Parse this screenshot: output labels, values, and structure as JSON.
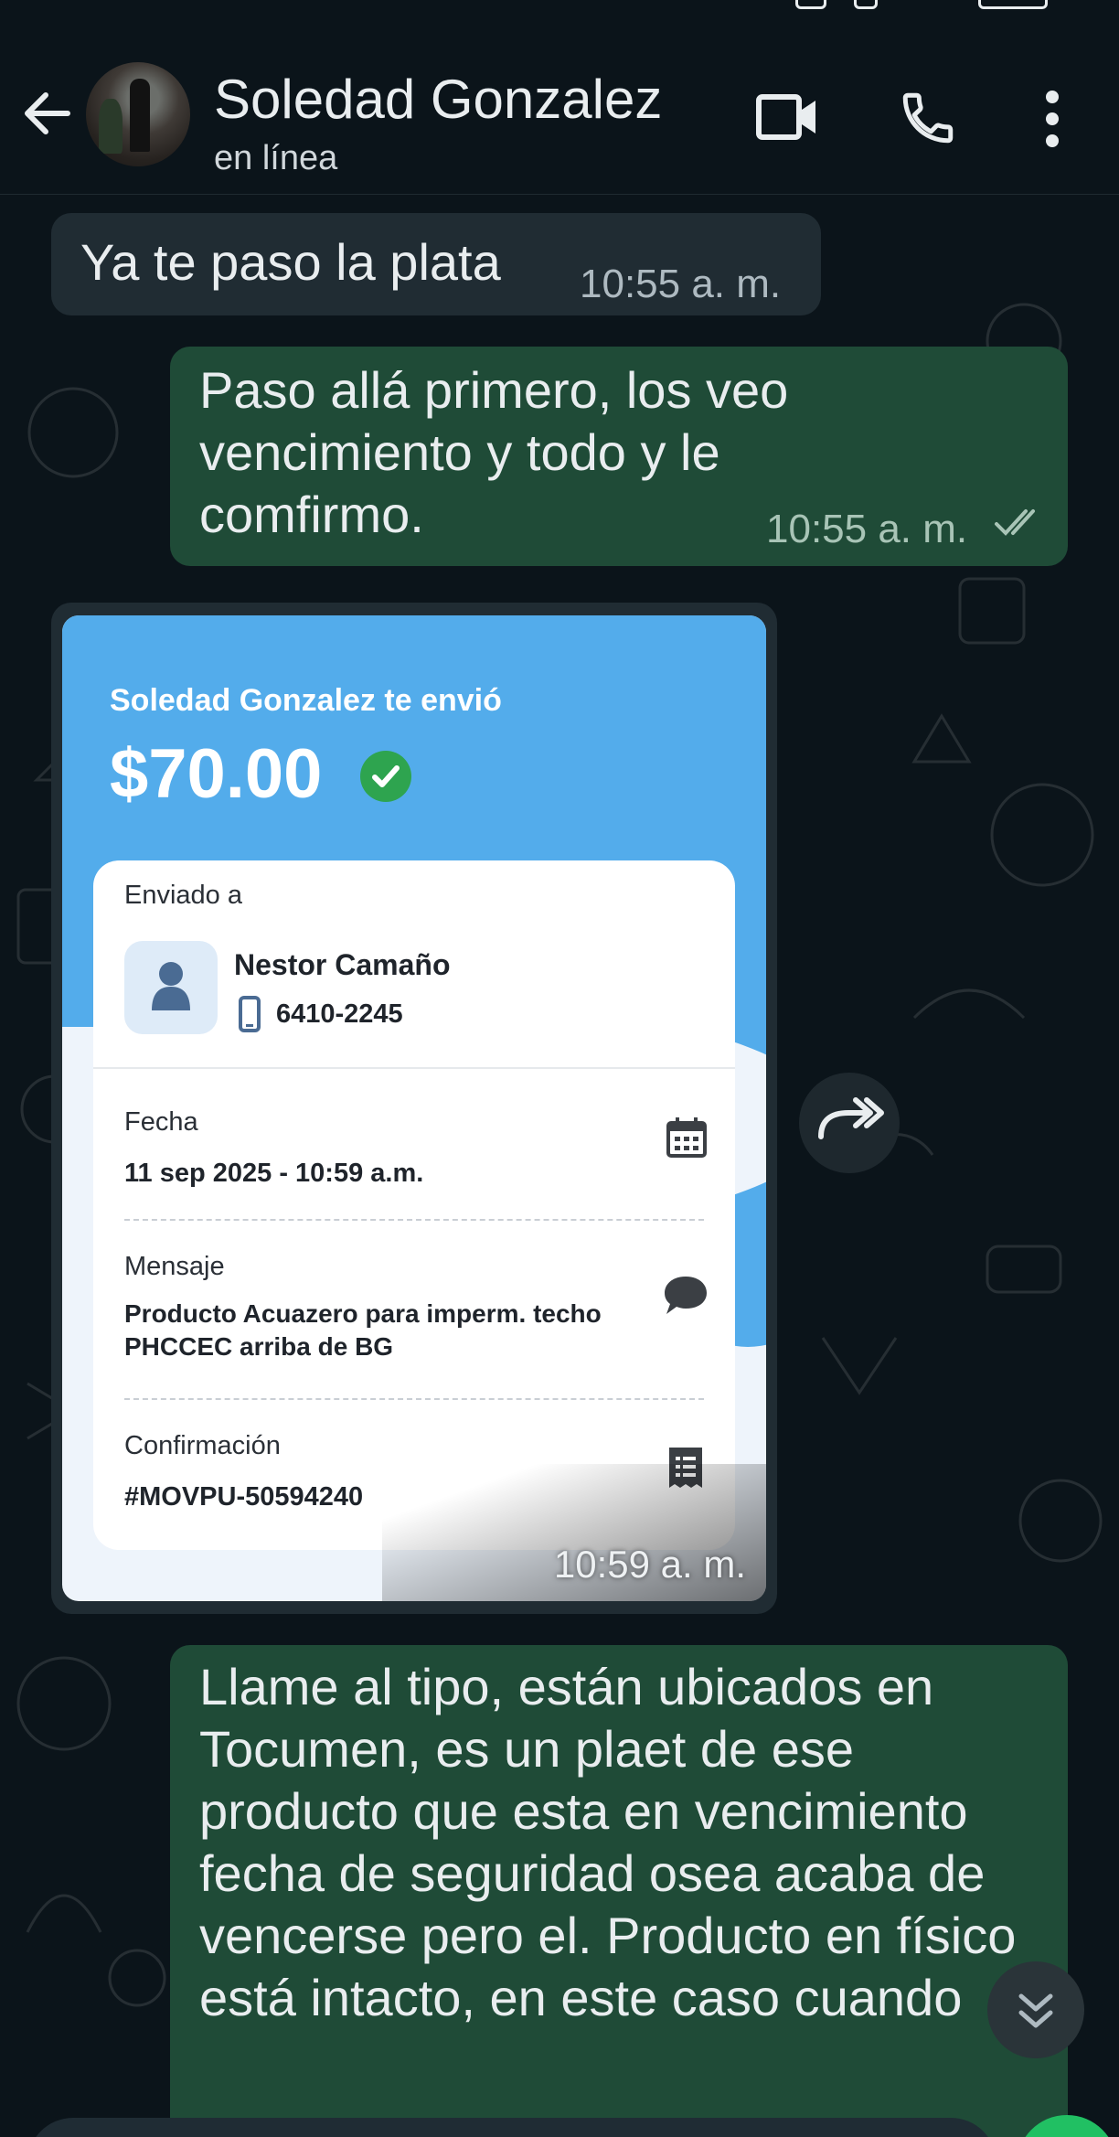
{
  "header": {
    "contact_name": "Soledad Gonzalez",
    "contact_status": "en línea",
    "icons": {
      "back": "back-arrow-icon",
      "video": "video-call-icon",
      "call": "phone-icon",
      "menu": "more-vert-icon"
    }
  },
  "colors": {
    "background": "#0b141a",
    "incoming_bubble": "#202c33",
    "outgoing_bubble": "#1f4b37",
    "receipt_accent": "#53aceb",
    "online_green": "#21c063"
  },
  "messages": [
    {
      "direction": "in",
      "text": "Ya te paso la plata",
      "time": "10:55 a. m."
    },
    {
      "direction": "out",
      "text": "Paso allá primero, los veo vencimiento y todo y le comfirmo.",
      "time": "10:55 a. m.",
      "ticks": "double-check-icon"
    },
    {
      "direction": "in",
      "type": "image",
      "time": "10:59 a. m."
    },
    {
      "direction": "out",
      "text": "Llame al tipo, están ubicados en Tocumen, es un plaet de ese producto que esta en vencimiento fecha de seguridad osea acaba de vencerse pero el. Producto en físico está intacto,   en este caso cuando"
    }
  ],
  "receipt": {
    "sender_line": "Soledad Gonzalez te envió",
    "amount": "$70.00",
    "sent_to_label": "Enviado a",
    "recipient_name": "Nestor Camaño",
    "recipient_phone": "6410-2245",
    "date_label": "Fecha",
    "date_value": "11 sep 2025 - 10:59 a.m.",
    "message_label": "Mensaje",
    "message_line1": "Producto Acuazero para imperm. techo",
    "message_line2": "PHCCEC arriba de BG",
    "confirmation_label": "Confirmación",
    "confirmation_value": "#MOVPU-50594240"
  }
}
